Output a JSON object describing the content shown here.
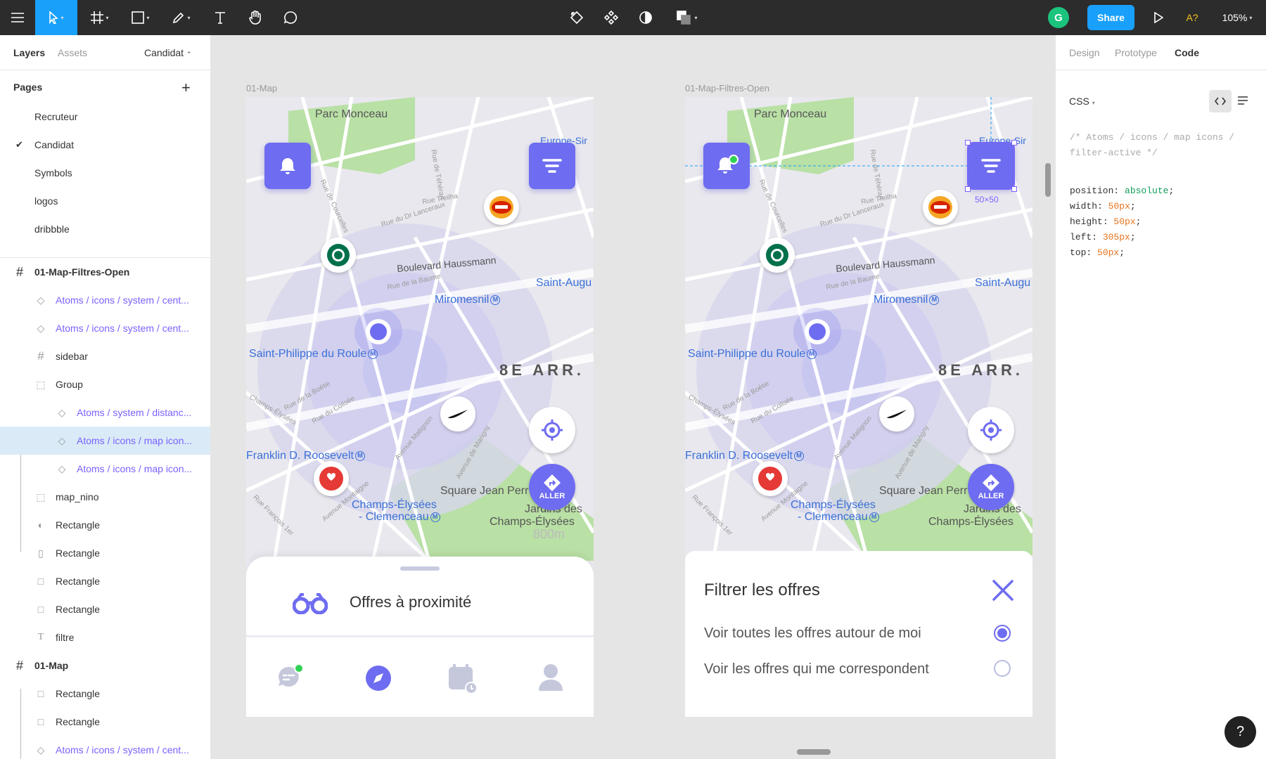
{
  "toolbar": {
    "zoom": "105%",
    "share_label": "Share",
    "avatar_initial": "G",
    "font_warning": "A?"
  },
  "left_panel": {
    "tabs": [
      "Layers",
      "Assets"
    ],
    "page_selector": "Candidat",
    "pages_title": "Pages",
    "pages": [
      "Recruteur",
      "Candidat",
      "Symbols",
      "logos",
      "dribbble"
    ],
    "layers": [
      "01-Map-Filtres-Open",
      "Atoms / icons / system / cent...",
      "Atoms / icons / system / cent...",
      "sidebar",
      "Group",
      "Atoms / system / distanc...",
      "Atoms / icons / map icon...",
      "Atoms / icons / map icon...",
      "map_nino",
      "Rectangle",
      "Rectangle",
      "Rectangle",
      "Rectangle",
      "filtre",
      "01-Map",
      "Rectangle",
      "Rectangle",
      "Atoms / icons / system / cent..."
    ]
  },
  "canvas": {
    "frame1_label": "01-Map",
    "frame2_label": "01-Map-Filtres-Open",
    "map": {
      "parc": "Parc Monceau",
      "europe": "Europe-Sir",
      "saint_aug": "Saint-Augu",
      "miromesnil": "Miromesnil",
      "saint_philippe": "Saint-Philippe du Roule",
      "arr": "8E ARR.",
      "franklin": "Franklin D. Roosevelt",
      "square": "Square Jean Perr",
      "champs1": "Champs-Élysées",
      "champs2": "- Clemenceau",
      "jardins1": "Jardins des",
      "jardins2": "Champs-Élysées",
      "distance": "800m",
      "haussmann": "Boulevard Haussmann",
      "go_label": "ALLER",
      "metro": "M",
      "streets": [
        "Rue de Courcelles",
        "Rue du Dr Lanceraux",
        "Rue Treilha",
        "Rue de la Baume",
        "Rue de Téhéran",
        "Avenue Matignon",
        "Avenue de Marigny",
        "Rue de la Boétie",
        "Rue du Colisée",
        "Avenue Montaigne",
        "Rue François 1er",
        "Champs-Élysées"
      ]
    },
    "sheet1": {
      "title": "Offres à proximité"
    },
    "sheet2": {
      "title": "Filtrer les offres",
      "option1": "Voir toutes les offres autour de moi",
      "option2": "Voir les offres qui me correspondent",
      "selected_option": 1
    },
    "selection_size": "50×50"
  },
  "right_panel": {
    "tabs": [
      "Design",
      "Prototype",
      "Code"
    ],
    "active_tab": "Code",
    "language": "CSS",
    "comment_line1": "/* Atoms / icons / map icons /",
    "comment_line2": "filter-active */",
    "css": [
      {
        "prop": "position",
        "value": "absolute"
      },
      {
        "prop": "width",
        "value": "50px"
      },
      {
        "prop": "height",
        "value": "50px"
      },
      {
        "prop": "left",
        "value": "305px"
      },
      {
        "prop": "top",
        "value": "50px"
      }
    ]
  },
  "colors": {
    "accent": "#6e6cf0",
    "figma_blue": "#18a0fb",
    "selection": "#7b61ff",
    "dark_toolbar": "#2c2c2c"
  }
}
